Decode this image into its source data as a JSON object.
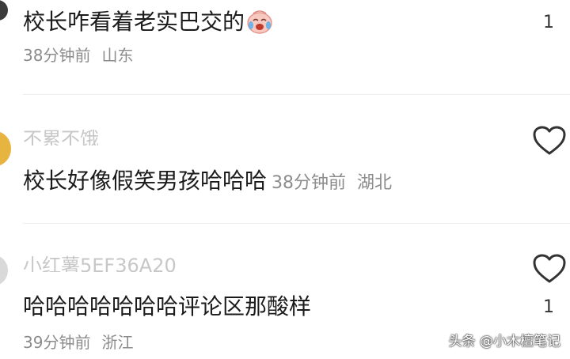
{
  "comments": [
    {
      "text": "校长咋看着老实巴交的",
      "emoji_icon": "crying-laughing-face-icon",
      "time": "38分钟前",
      "location": "山东",
      "likes": "1"
    },
    {
      "username": "不累不饿",
      "text": "校长好像假笑男孩哈哈哈",
      "time": "38分钟前",
      "location": "湖北",
      "like_icon": "heart-outline-icon"
    },
    {
      "username": "小红薯5EF36A20",
      "text": "哈哈哈哈哈哈哈评论区那酸样",
      "time": "39分钟前",
      "location": "浙江",
      "likes": "1",
      "like_icon": "heart-outline-icon"
    }
  ],
  "watermark": "头条 @小木檀笔记",
  "colors": {
    "text": "#1b1b1b",
    "meta": "#8c8c8c",
    "username": "#9a9a9a",
    "background": "#ffffff"
  }
}
